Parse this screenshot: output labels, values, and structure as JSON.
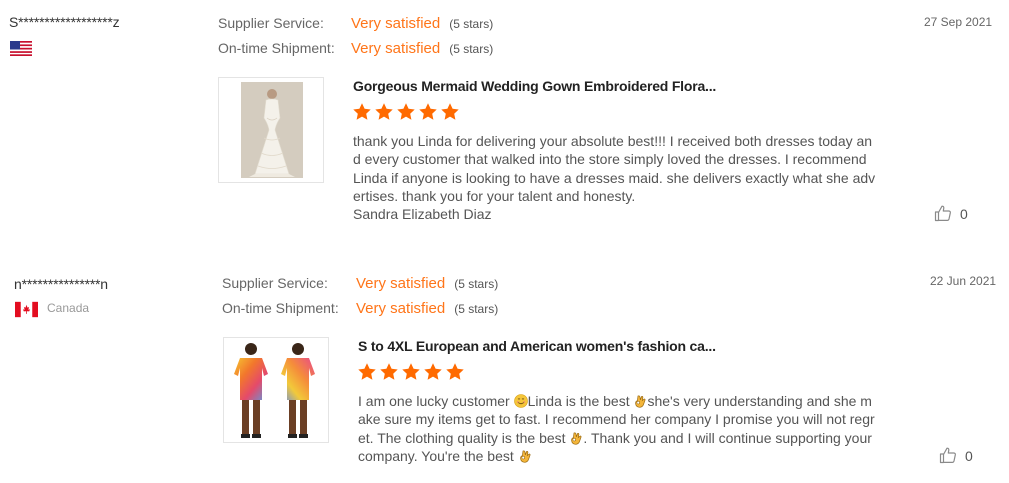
{
  "reviews": [
    {
      "buyer": "S******************z",
      "flag": "us-flag-icon",
      "country": "",
      "supplier_service_label": "Supplier Service:",
      "supplier_service_value": "Very satisfied",
      "supplier_service_stars": "(5 stars)",
      "shipment_label": "On-time Shipment:",
      "shipment_value": "Very satisfied",
      "shipment_stars": "(5 stars)",
      "date": "27 Sep 2021",
      "product_title": "Gorgeous Mermaid Wedding Gown Embroidered Flora...",
      "rating": 5,
      "feedback": "thank you Linda for delivering your absolute best!!! I received both dresses today and every customer that walked into the store simply loved the dresses.  I recommend Linda if anyone is looking to have a dresses maid. she delivers exactly what she advertises. thank you for your talent and honesty.",
      "signature": "Sandra Elizabeth Diaz",
      "likes": "0"
    },
    {
      "buyer": "n***************n",
      "flag": "canada-flag-icon",
      "country": "Canada",
      "supplier_service_label": "Supplier Service:",
      "supplier_service_value": "Very satisfied",
      "supplier_service_stars": "(5 stars)",
      "shipment_label": "On-time Shipment:",
      "shipment_value": "Very satisfied",
      "shipment_stars": "(5 stars)",
      "date": "22 Jun 2021",
      "product_title": "S to 4XL European and American women's fashion ca...",
      "rating": 5,
      "feedback_parts": [
        "I am one lucky customer ",
        "Linda is the best ",
        "she's very understanding and she make sure my items get to fast. I recommend her company I promise you will not regret. The clothing quality is the best ",
        ". Thank you and I will continue supporting your company. You're the best "
      ],
      "likes": "0"
    }
  ],
  "colors": {
    "accent": "#ff7519",
    "star": "#ff6a00"
  }
}
